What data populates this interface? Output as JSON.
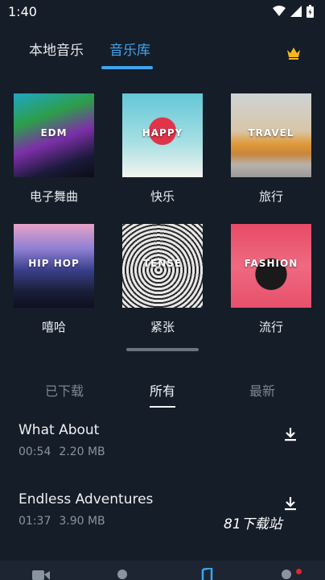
{
  "status_bar": {
    "time": "1:40"
  },
  "top_tabs": [
    {
      "label": "本地音乐"
    },
    {
      "label": "音乐库"
    }
  ],
  "genres": [
    {
      "cover_text": "EDM",
      "label": "电子舞曲"
    },
    {
      "cover_text": "HAPPY",
      "label": "快乐"
    },
    {
      "cover_text": "TRAVEL",
      "label": "旅行"
    },
    {
      "cover_text": "HIP HOP",
      "label": "嘻哈"
    },
    {
      "cover_text": "TENSE",
      "label": "紧张"
    },
    {
      "cover_text": "FASHION",
      "label": "流行"
    }
  ],
  "sub_tabs": [
    {
      "label": "已下载"
    },
    {
      "label": "所有"
    },
    {
      "label": "最新"
    }
  ],
  "tracks": [
    {
      "title": "What About",
      "duration": "00:54",
      "size": "2.20 MB"
    },
    {
      "title": "Endless Adventures",
      "duration": "01:37",
      "size": "3.90 MB"
    }
  ],
  "watermark": "81下载站",
  "colors": {
    "accent": "#3fa4f0",
    "background": "#151d28",
    "crown": "#f5b81c",
    "badge": "#e0262b"
  }
}
